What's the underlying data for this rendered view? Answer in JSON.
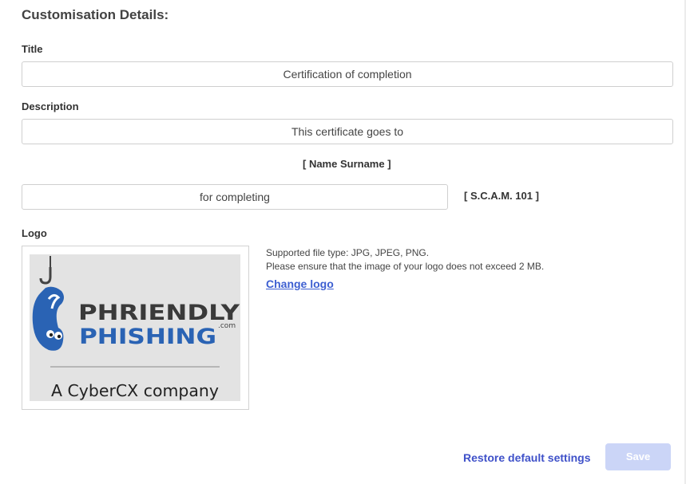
{
  "form": {
    "heading": "Customisation Details:",
    "title": {
      "label": "Title",
      "value": "Certification of completion"
    },
    "description": {
      "label": "Description",
      "value": "This certificate goes to"
    },
    "name_placeholder": "[ Name Surname ]",
    "completing": {
      "value": "for completing"
    },
    "course_placeholder": "[ S.C.A.M. 101 ]",
    "logo": {
      "label": "Logo",
      "image_text_line1": "PHRIENDLY",
      "image_text_line2": "PHISHING",
      "image_text_dotcom": ".com",
      "image_tagline": "A CyberCX company",
      "supported_types": "Supported file type: JPG, JPEG, PNG.",
      "size_note": "Please ensure that the image of your logo does not exceed 2 MB.",
      "change_label": "Change logo"
    }
  },
  "footer": {
    "restore_label": "Restore default settings",
    "save_label": "Save"
  },
  "colors": {
    "link_blue": "#3d5fd1",
    "save_disabled": "#cbd5f7",
    "brand_dark": "#3a3a3a",
    "brand_blue": "#2a63b4"
  }
}
